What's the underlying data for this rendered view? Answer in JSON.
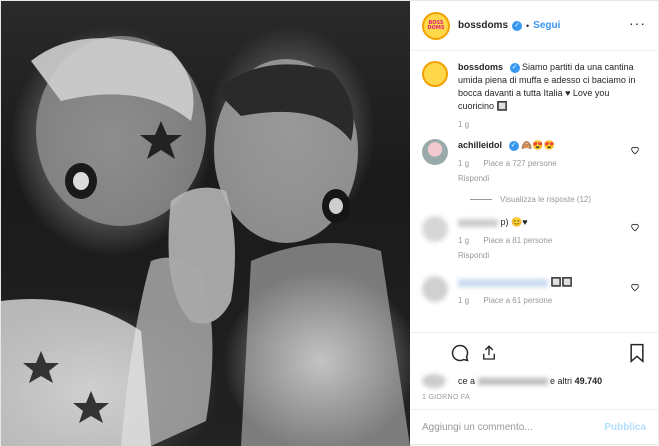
{
  "header": {
    "avatar_text": "BOSS DOMS",
    "username": "bossdoms",
    "separator": "•",
    "follow_label": "Segui",
    "more_label": "···"
  },
  "caption": {
    "username": "bossdoms",
    "text": "Siamo partiti da una cantina umida piena di muffa e adesso ci baciamo in bocca davanti a tutta Italia ♥ Love you cuoricino 🔲",
    "time": "1 g"
  },
  "comments": [
    {
      "username": "achilleidol",
      "text": "🙈😍😍",
      "time": "1 g",
      "likes": "Piace a 727 persone",
      "reply": "Rispondi",
      "view_replies": "Visualizza le risposte (12)"
    },
    {
      "username": "",
      "text": "p) 😊♥",
      "time": "1 g",
      "likes": "Piace a 81 persone",
      "reply": "Rispondi"
    },
    {
      "username": "",
      "text": "🔲🔲",
      "time": "1 g",
      "likes": "Piace a 61 persone",
      "reply": ""
    }
  ],
  "likes_line": {
    "prefix": "ce a",
    "suffix": "e altri",
    "count": "49.740"
  },
  "date_label": "1 GIORNO FA",
  "comment_box": {
    "placeholder": "Aggiungi un commento...",
    "publish_label": "Pubblica"
  },
  "colors": {
    "accent": "#3897f0",
    "publish_disabled": "#b2dffc",
    "meta_gray": "#999999"
  }
}
